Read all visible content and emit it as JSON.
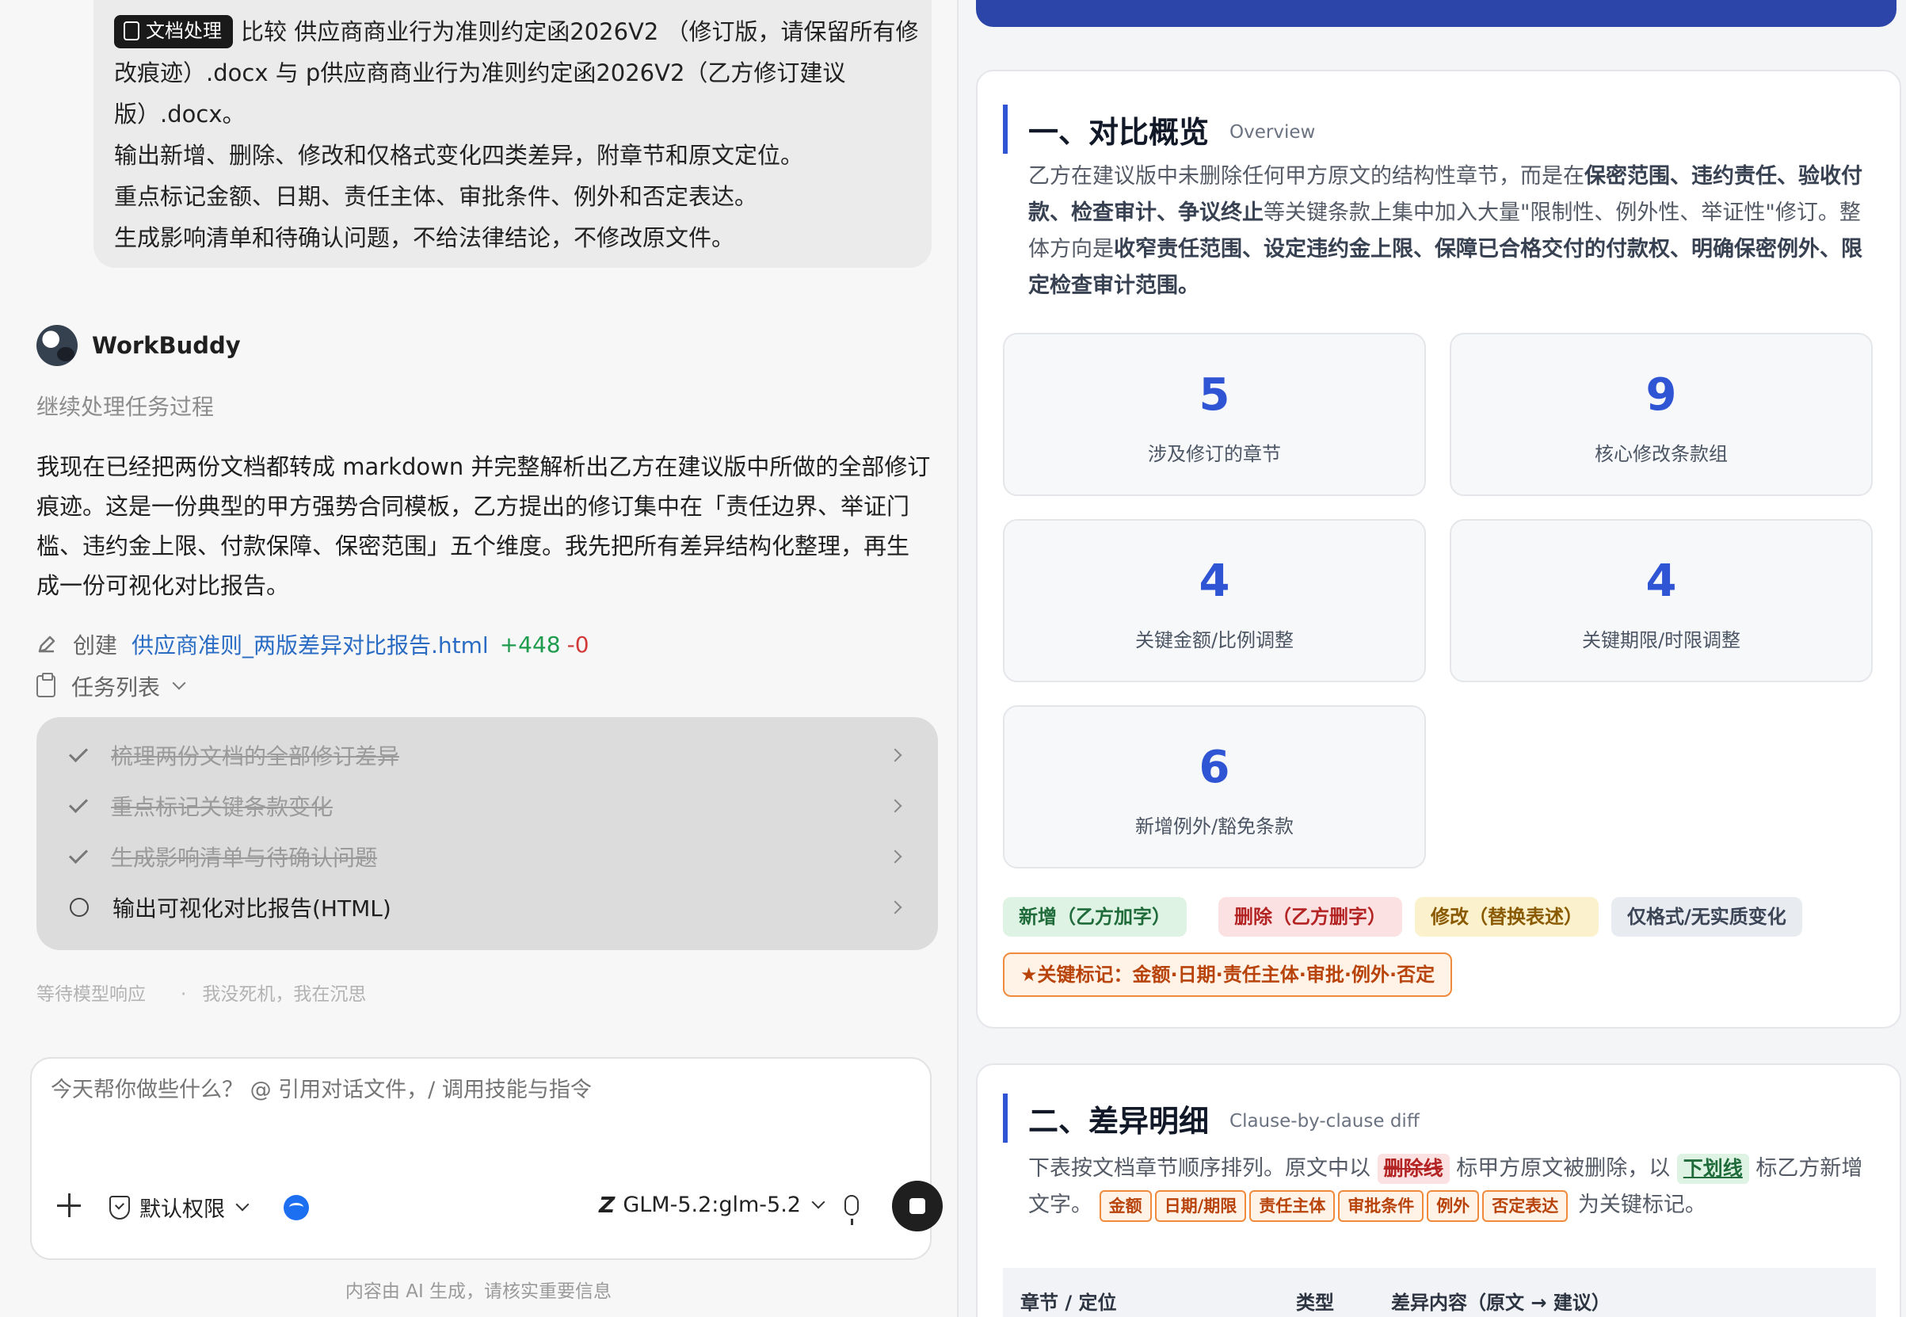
{
  "chat": {
    "user_message": {
      "tag": "文档处理",
      "lines": [
        "比较 供应商商业行为准则约定函2026V2 （修订版，请保留所有修",
        "改痕迹）.docx 与 p供应商商业行为准则约定函2026V2（乙方修订建议",
        "版）.docx。",
        "输出新增、删除、修改和仅格式变化四类差异，附章节和原文定位。",
        "重点标记金额、日期、责任主体、审批条件、例外和否定表达。",
        "生成影响清单和待确认问题，不给法律结论，不修改原文件。"
      ]
    },
    "bot_name": "WorkBuddy",
    "status": "继续处理任务过程",
    "body": "我现在已经把两份文档都转成 markdown 并完整解析出乙方在建议版中所做的全部修订痕迹。这是一份典型的甲方强势合同模板，乙方提出的修订集中在「责任边界、举证门槛、违约金上限、付款保障、保密范围」五个维度。我先把所有差异结构化整理，再生成一份可视化对比报告。",
    "create": {
      "label": "创建",
      "file": "供应商准则_两版差异对比报告.html",
      "added": "+448",
      "removed": "-0"
    },
    "task_list_label": "任务列表",
    "tasks": [
      {
        "text": "梳理两份文档的全部修订差异",
        "done": true
      },
      {
        "text": "重点标记关键条款变化",
        "done": true
      },
      {
        "text": "生成影响清单与待确认问题",
        "done": true
      },
      {
        "text": "输出可视化对比报告(HTML)",
        "done": false
      }
    ],
    "waiting": "等待模型响应",
    "waiting_sep": "·",
    "waiting_note": "我没死机，我在沉思",
    "input_placeholder": "今天帮你做些什么？ @ 引用对话文件，/ 调用技能与指令",
    "permission": "默认权限",
    "model": "GLM-5.2:glm-5.2",
    "model_logo": "Z",
    "disclaimer": "内容由 AI 生成，请核实重要信息"
  },
  "report": {
    "section1": {
      "title": "一、对比概览",
      "subtitle": "Overview",
      "overview_parts": [
        {
          "t": "乙方在建议版中未删除任何甲方原文的结构性章节，而是在",
          "b": false
        },
        {
          "t": "保密范围、违约责任、验收付款、检查审计、争议终止",
          "b": true
        },
        {
          "t": "等关键条款上集中加入大量\"限制性、例外性、举证性\"修订。整体方向是",
          "b": false
        },
        {
          "t": "收窄责任范围、设定违约金上限、保障已合格交付的付款权、明确保密例外、限定检查审计范围。",
          "b": true
        }
      ],
      "stats": [
        {
          "num": "5",
          "caption": "涉及修订的章节"
        },
        {
          "num": "9",
          "caption": "核心修改条款组"
        },
        {
          "num": "4",
          "caption": "关键金额/比例调整"
        },
        {
          "num": "4",
          "caption": "关键期限/时限调整"
        },
        {
          "num": "6",
          "caption": "新增例外/豁免条款"
        }
      ],
      "legend": {
        "add": "新增（乙方加字）",
        "del": "删除（乙方删字）",
        "mod": "修改（替换表述）",
        "fmt": "仅格式/无实质变化"
      },
      "key_mark": "★关键标记：金额·日期·责任主体·审批·例外·否定",
      "colors": {
        "accent": "#2f55d4",
        "add": "#1f6b3a",
        "del": "#b42323",
        "mod": "#8a5a00",
        "key": "#b8440c"
      }
    },
    "section2": {
      "title": "二、差异明细",
      "subtitle": "Clause-by-clause diff",
      "intro_a": "下表按文档章节顺序排列。原文中以",
      "strike_label": "删除线",
      "intro_b": "标甲方原文被删除，以",
      "under_label": "下划线",
      "intro_c": "标乙方新增文字。",
      "chips": [
        "金额",
        "日期/期限",
        "责任主体",
        "审批条件",
        "例外",
        "否定表达"
      ],
      "intro_d": "为关键标记。",
      "columns": [
        "章节 / 定位",
        "类型",
        "差异内容（原文 → 建议）"
      ]
    }
  }
}
